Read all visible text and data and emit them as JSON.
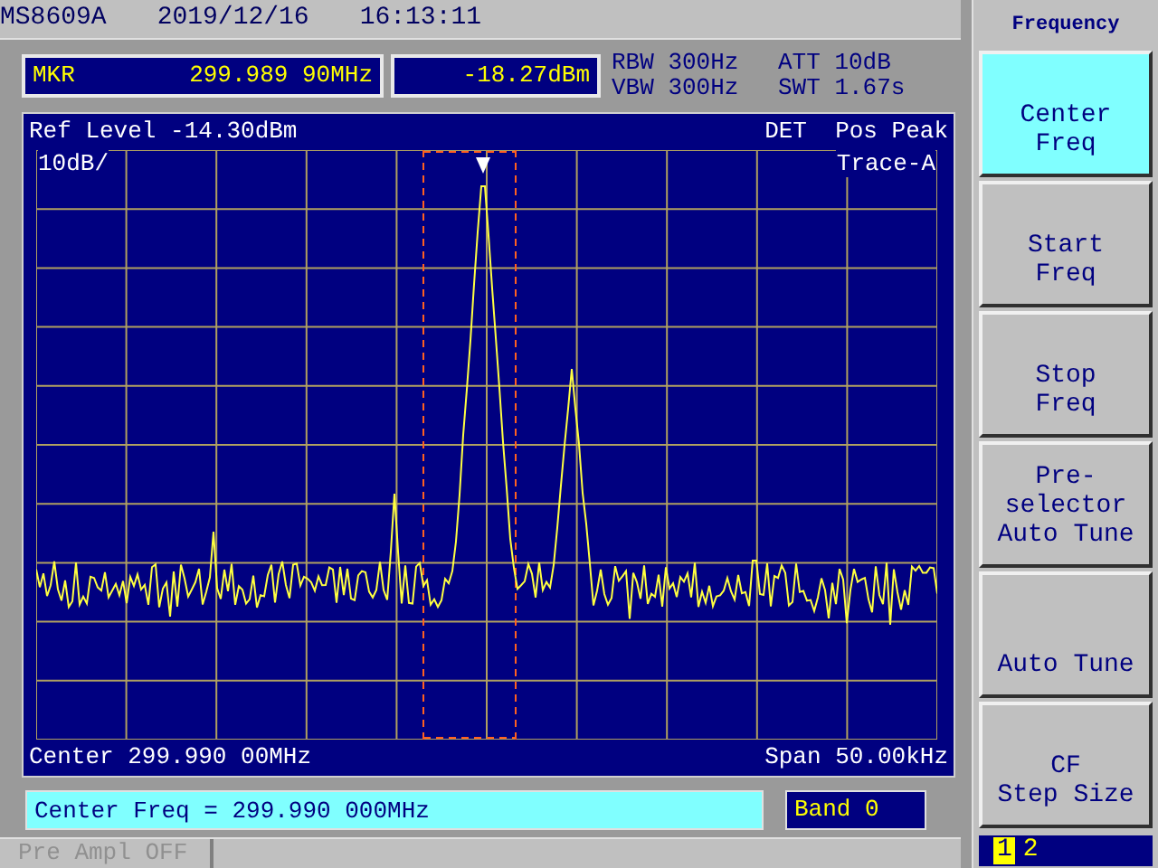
{
  "header": {
    "model": "MS8609A",
    "date": "2019/12/16",
    "time": "16:13:11"
  },
  "marker": {
    "label": "MKR",
    "frequency": "299.989 90MHz",
    "amplitude": "-18.27dBm"
  },
  "settings": [
    "RBW 300Hz",
    "ATT 10dB",
    "VBW 300Hz",
    "SWT 1.67s"
  ],
  "plot": {
    "ref_level": "Ref Level -14.30dBm",
    "detector": "DET  Pos Peak",
    "scale": "10dB/",
    "trace": "Trace-A",
    "center": "Center 299.990 00MHz",
    "span": "Span 50.00kHz"
  },
  "entry": {
    "value": "Center Freq = 299.990 000MHz"
  },
  "band": "Band 0",
  "status_bar": {
    "text": "Pre Ampl OFF",
    "disabled": true
  },
  "menu": {
    "title": "Frequency",
    "softkeys": [
      {
        "lines": [
          "Center",
          "Freq"
        ],
        "selected": true
      },
      {
        "lines": [
          "Start",
          "Freq"
        ],
        "selected": false
      },
      {
        "lines": [
          "Stop",
          "Freq"
        ],
        "selected": false
      },
      {
        "lines": [
          "Pre-",
          "selector",
          "Auto Tune"
        ],
        "selected": false
      },
      {
        "lines": [
          "Auto Tune"
        ],
        "selected": false
      },
      {
        "lines": [
          "CF",
          "Step Size"
        ],
        "selected": false
      }
    ],
    "pages": [
      {
        "label": "1",
        "selected": true
      },
      {
        "label": "2",
        "selected": false
      }
    ]
  }
}
